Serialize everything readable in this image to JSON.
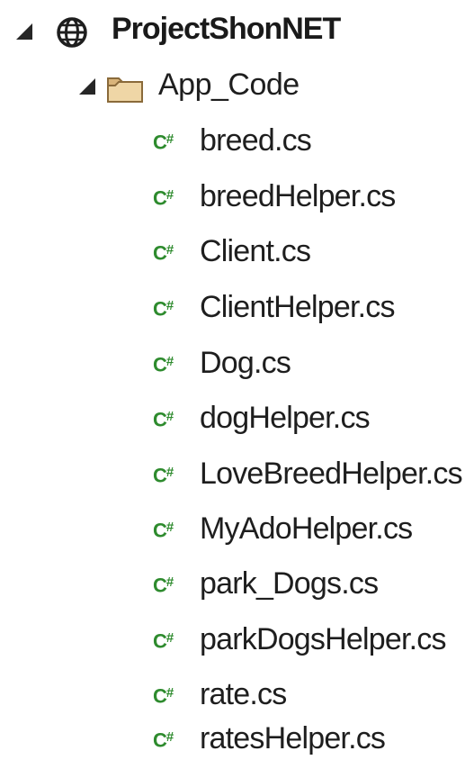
{
  "solution_explorer": {
    "project": {
      "label": "ProjectShonNET",
      "icon": "globe-icon",
      "expanded": true
    },
    "folder": {
      "label": "App_Code",
      "icon": "folder-icon",
      "expanded": true
    },
    "files": [
      {
        "label": "breed.cs",
        "icon": "csharp-file-icon"
      },
      {
        "label": "breedHelper.cs",
        "icon": "csharp-file-icon"
      },
      {
        "label": "Client.cs",
        "icon": "csharp-file-icon"
      },
      {
        "label": "ClientHelper.cs",
        "icon": "csharp-file-icon"
      },
      {
        "label": "Dog.cs",
        "icon": "csharp-file-icon"
      },
      {
        "label": "dogHelper.cs",
        "icon": "csharp-file-icon"
      },
      {
        "label": "LoveBreedHelper.cs",
        "icon": "csharp-file-icon"
      },
      {
        "label": "MyAdoHelper.cs",
        "icon": "csharp-file-icon"
      },
      {
        "label": "park_Dogs.cs",
        "icon": "csharp-file-icon"
      },
      {
        "label": "parkDogsHelper.cs",
        "icon": "csharp-file-icon"
      },
      {
        "label": "rate.cs",
        "icon": "csharp-file-icon"
      },
      {
        "label": "ratesHelper.cs",
        "icon": "csharp-file-icon"
      }
    ],
    "csharp_icon_text": "C",
    "csharp_icon_hash": "#"
  },
  "colors": {
    "csharp_icon": "#2e8b2e",
    "folder_fill": "#e8c98f",
    "text": "#1e1e1e"
  }
}
